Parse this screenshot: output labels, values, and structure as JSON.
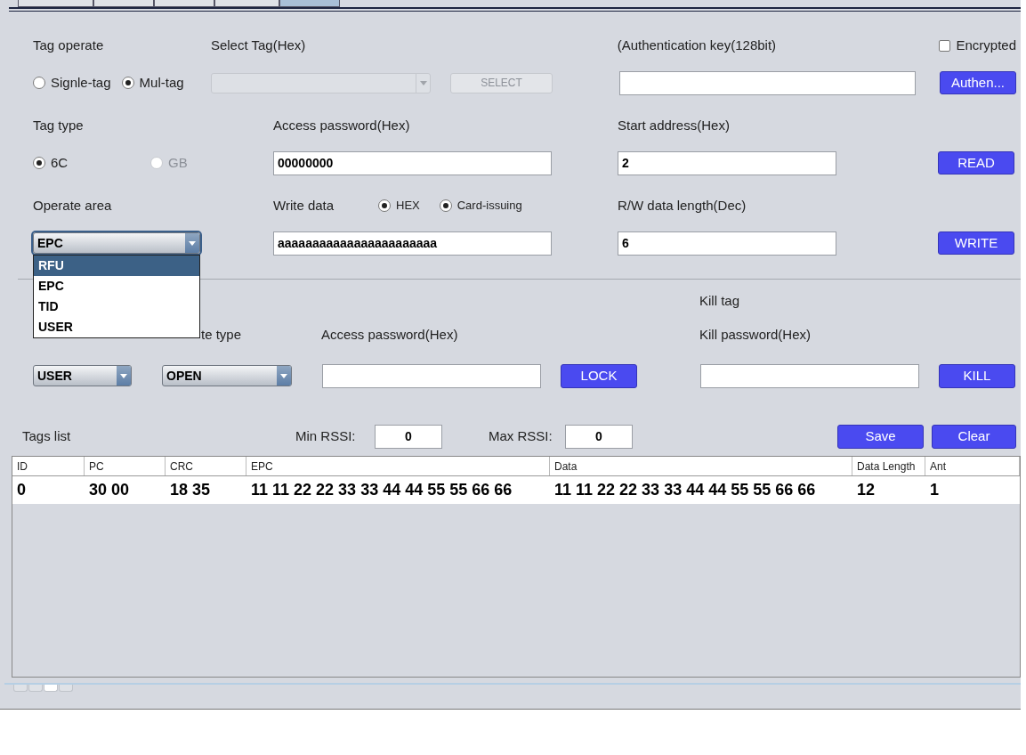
{
  "tabs": [
    {
      "selected": false
    },
    {
      "selected": false
    },
    {
      "selected": false
    },
    {
      "selected": false
    },
    {
      "selected": true
    }
  ],
  "tag_operate": {
    "label": "Tag operate",
    "options": [
      {
        "label": "Signle-tag",
        "selected": false
      },
      {
        "label": "Mul-tag",
        "selected": true
      }
    ]
  },
  "select_tag": {
    "label": "Select Tag(Hex)",
    "disabled": true,
    "button": "SELECT"
  },
  "auth_key": {
    "label": "(Authentication key(128bit)",
    "button": "Authen..."
  },
  "encrypted": {
    "label": "Encrypted",
    "checked": false
  },
  "tag_type": {
    "label": "Tag type",
    "options": [
      {
        "label": "6C",
        "selected": true,
        "disabled": false
      },
      {
        "label": "GB",
        "selected": false,
        "disabled": true
      }
    ]
  },
  "access_password": {
    "label": "Access password(Hex)",
    "value": "00000000"
  },
  "start_address": {
    "label": "Start address(Hex)",
    "value": "2",
    "button": "READ"
  },
  "operate_area": {
    "label": "Operate area",
    "value": "EPC",
    "expanded": true,
    "options": [
      {
        "label": "RFU",
        "highlighted": true
      },
      {
        "label": "EPC",
        "highlighted": false
      },
      {
        "label": "TID",
        "highlighted": false
      },
      {
        "label": "USER",
        "highlighted": false
      }
    ]
  },
  "write_data": {
    "label": "Write data",
    "formats": [
      {
        "label": "HEX",
        "selected": true
      },
      {
        "label": "Card-issuing",
        "selected": true
      }
    ],
    "value": "aaaaaaaaaaaaaaaaaaaaaaa"
  },
  "rw_length": {
    "label": "R/W data length(Dec)",
    "value": "6",
    "button": "WRITE"
  },
  "lock": {
    "area_value": "USER",
    "type_label": "te type",
    "type_value": "OPEN",
    "password_label": "Access password(Hex)",
    "button": "LOCK"
  },
  "kill": {
    "title": "Kill tag",
    "password_label": "Kill password(Hex)",
    "button": "KILL"
  },
  "tags_list": {
    "title": "Tags list",
    "min_rssi_label": "Min RSSI:",
    "min_rssi": "0",
    "max_rssi_label": "Max RSSI:",
    "max_rssi": "0",
    "buttons": [
      "Save",
      "Clear"
    ]
  },
  "table": {
    "columns": [
      "ID",
      "PC",
      "CRC",
      "EPC",
      "Data",
      "Data Length",
      "Ant"
    ],
    "rows": [
      [
        "0",
        "30 00",
        "18 35",
        "11 11 22 22 33 33 44 44 55 55 66 66",
        "11 11 22 22 33 33 44 44 55 55 66 66",
        "12",
        "1"
      ]
    ]
  },
  "bottom_tabs": [
    {
      "selected": false
    },
    {
      "selected": false
    },
    {
      "selected": true
    },
    {
      "selected": false
    }
  ]
}
